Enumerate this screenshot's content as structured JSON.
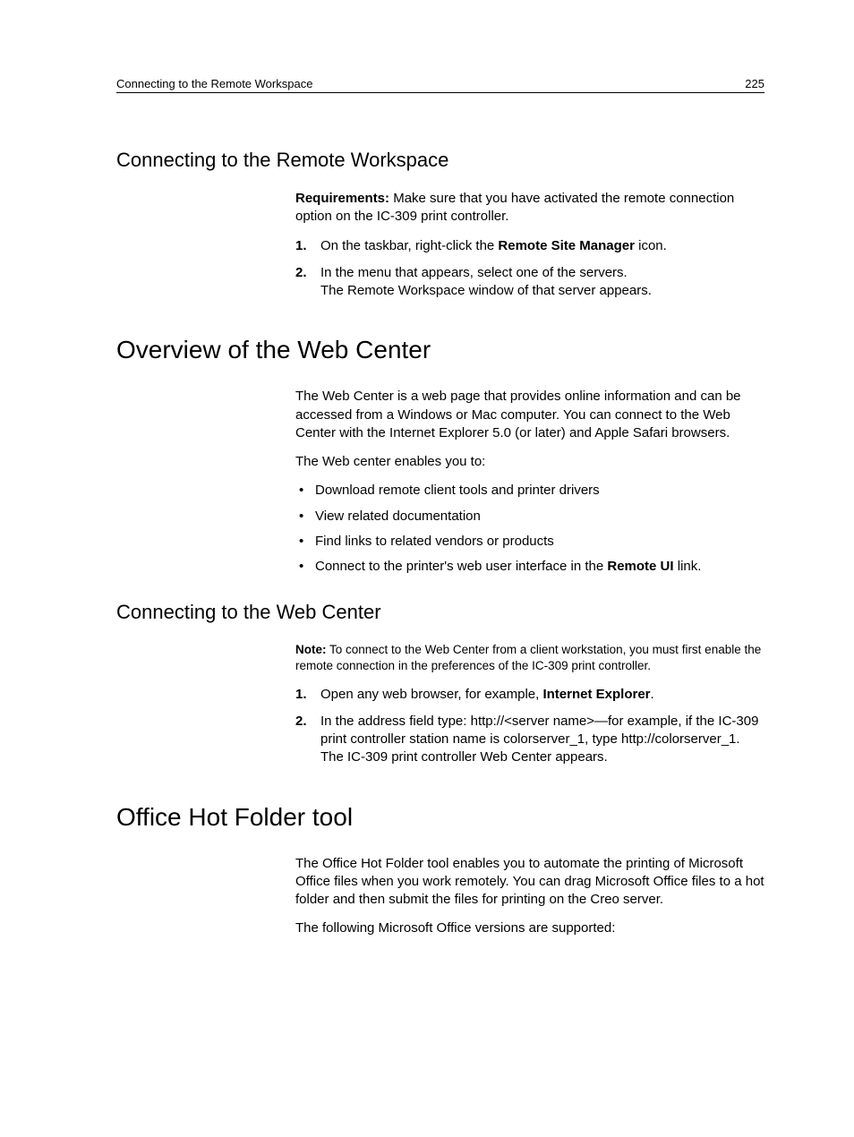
{
  "header": {
    "title": "Connecting to the Remote Workspace",
    "page_number": "225"
  },
  "s1": {
    "heading": "Connecting to the Remote Workspace",
    "req_label": "Requirements:",
    "req_text": " Make sure that you have activated the remote connection option on the IC-309 print controller.",
    "step1_num": "1.",
    "step1_a": "On the taskbar, right-click the ",
    "step1_b": "Remote Site Manager",
    "step1_c": " icon.",
    "step2_num": "2.",
    "step2_a": "In the menu that appears, select one of the servers.",
    "step2_b": "The Remote Workspace window of that server appears."
  },
  "s2": {
    "heading": "Overview of the Web Center",
    "p1": "The Web Center is a web page that provides online information and can be accessed from a Windows or Mac computer. You can connect to the Web Center with the Internet Explorer 5.0 (or later) and Apple Safari browsers.",
    "p2": "The Web center enables you to:",
    "b1": "Download remote client tools and printer drivers",
    "b2": "View related documentation",
    "b3": "Find links to related vendors or products",
    "b4_a": "Connect to the printer's web user interface in the ",
    "b4_b": "Remote UI",
    "b4_c": " link."
  },
  "s3": {
    "heading": "Connecting to the Web Center",
    "note_label": "Note:",
    "note_text": " To connect to the Web Center from a client workstation, you must first enable the remote connection in the preferences of the IC-309 print controller.",
    "step1_num": "1.",
    "step1_a": "Open any web browser, for example, ",
    "step1_b": "Internet Explorer",
    "step1_c": ".",
    "step2_num": "2.",
    "step2_a": "In the address field type: http://<server name>—for example, if the IC-309 print controller station name is colorserver_1, type http://colorserver_1.",
    "step2_b": "The IC-309 print controller Web Center appears."
  },
  "s4": {
    "heading": "Office Hot Folder tool",
    "p1": "The Office Hot Folder tool enables you to automate the printing of Microsoft Office files when you work remotely. You can drag Microsoft Office files to a hot folder and then submit the files for printing on the Creo server.",
    "p2": "The following Microsoft Office versions are supported:"
  }
}
